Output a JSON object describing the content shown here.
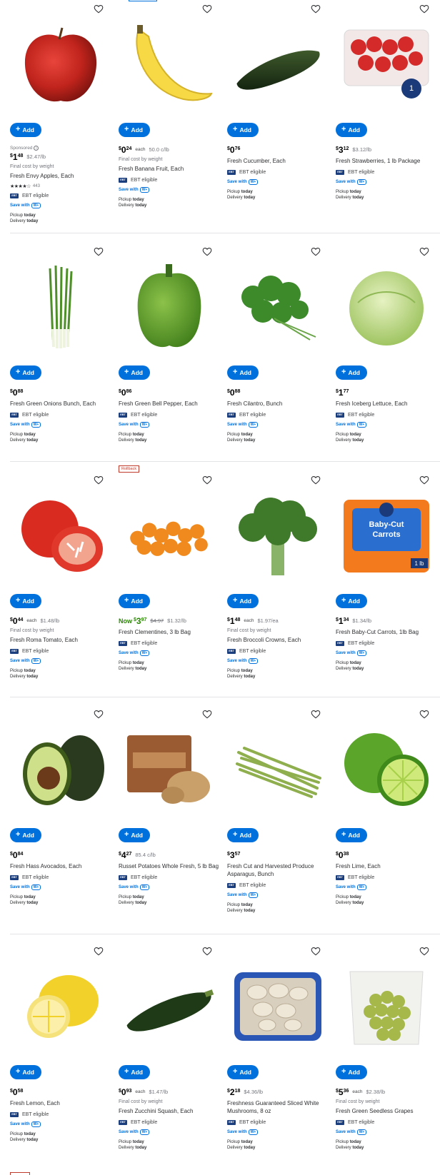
{
  "labels": {
    "add": "Add",
    "sponsored": "Sponsored",
    "final_cost": "Final cost by weight",
    "ebt": "EBT eligible",
    "ebt_badge": "EBT",
    "save_with": "Save with",
    "wplus": "W+",
    "pickup": "Pickup",
    "delivery": "Delivery",
    "today": "today",
    "rollback": "Rollback",
    "now": "Now",
    "each": "each"
  },
  "colors": {
    "accent": "#0071dc",
    "rollback_green": "#2a8703",
    "rollback_red": "#c03a2b",
    "ebt_navy": "#1a3e7e"
  },
  "products": [
    {
      "name": "Fresh Envy Apples, Each",
      "dollars": "1",
      "cents": "48",
      "unit_price": "$2.47/lb",
      "final_cost": true,
      "sponsored": true,
      "rating_count": "443",
      "stars": 3.5,
      "image": "red-apple-image"
    },
    {
      "name": "Fresh Banana Fruit, Each",
      "dollars": "0",
      "cents": "24",
      "each": true,
      "unit_price": "50.0 c/lb",
      "final_cost": true,
      "image": "banana-image"
    },
    {
      "name": "Fresh Cucumber, Each",
      "dollars": "0",
      "cents": "76",
      "image": "cucumber-image"
    },
    {
      "name": "Fresh Strawberries, 1 lb Package",
      "dollars": "3",
      "cents": "12",
      "unit_price": "$3.12/lb",
      "image": "strawberries-image"
    },
    {
      "name": "Fresh Green Onions Bunch, Each",
      "dollars": "0",
      "cents": "88",
      "image": "green-onions-image"
    },
    {
      "name": "Fresh Green Bell Pepper, Each",
      "dollars": "0",
      "cents": "86",
      "image": "bell-pepper-image"
    },
    {
      "name": "Fresh Cilantro, Bunch",
      "dollars": "0",
      "cents": "88",
      "image": "cilantro-image"
    },
    {
      "name": "Fresh Iceberg Lettuce, Each",
      "dollars": "1",
      "cents": "77",
      "image": "lettuce-image"
    },
    {
      "name": "Fresh Roma Tomato, Each",
      "dollars": "0",
      "cents": "44",
      "each": true,
      "unit_price": "$1.48/lb",
      "final_cost": true,
      "image": "tomato-image"
    },
    {
      "name": "Fresh Clementines, 3 lb Bag",
      "dollars": "3",
      "cents": "97",
      "now": true,
      "was": "$4.97",
      "unit_price": "$1.32/lb",
      "rollback": true,
      "image": "clementines-image"
    },
    {
      "name": "Fresh Broccoli Crowns, Each",
      "dollars": "1",
      "cents": "48",
      "each": true,
      "unit_price": "$1.97/ea",
      "final_cost": true,
      "image": "broccoli-image"
    },
    {
      "name": "Fresh Baby-Cut Carrots, 1lb Bag",
      "dollars": "1",
      "cents": "34",
      "unit_price": "$1.34/lb",
      "image": "carrots-bag-image"
    },
    {
      "name": "Fresh Hass Avocados, Each",
      "dollars": "0",
      "cents": "84",
      "image": "avocado-image"
    },
    {
      "name": "Russet Potatoes Whole Fresh, 5 lb Bag",
      "dollars": "4",
      "cents": "27",
      "unit_price": "85.4 c/lb",
      "image": "potatoes-image"
    },
    {
      "name": "Fresh Cut and Harvested Produce Asparagus, Bunch",
      "dollars": "3",
      "cents": "57",
      "image": "asparagus-image"
    },
    {
      "name": "Fresh Lime, Each",
      "dollars": "0",
      "cents": "38",
      "image": "lime-image"
    },
    {
      "name": "Fresh Lemon, Each",
      "dollars": "0",
      "cents": "58",
      "image": "lemon-image"
    },
    {
      "name": "Fresh Zucchini Squash, Each",
      "dollars": "0",
      "cents": "93",
      "each": true,
      "unit_price": "$1.47/lb",
      "final_cost": true,
      "image": "zucchini-image"
    },
    {
      "name": "Freshness Guaranteed Sliced White Mushrooms, 8 oz",
      "dollars": "2",
      "cents": "18",
      "unit_price": "$4.36/lb",
      "image": "mushrooms-image"
    },
    {
      "name": "Fresh Green Seedless Grapes",
      "dollars": "5",
      "cents": "36",
      "each": true,
      "unit_price": "$2.38/lb",
      "final_cost": true,
      "image": "grapes-image"
    }
  ]
}
